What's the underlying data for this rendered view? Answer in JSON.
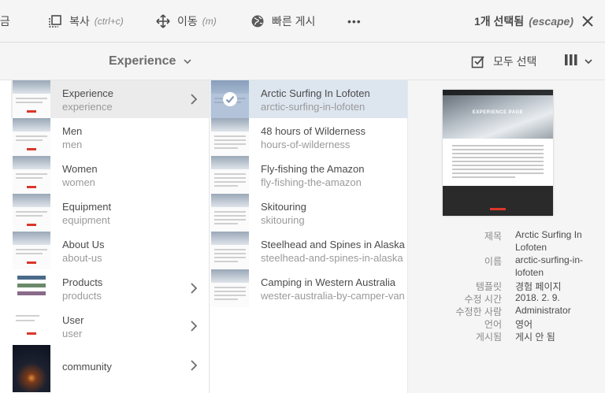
{
  "actionbar": {
    "partial_label": "잠금",
    "copy_label": "복사",
    "copy_shortcut": "(ctrl+c)",
    "move_label": "이동",
    "move_shortcut": "(m)",
    "quickpublish_label": "빠른 게시",
    "more_label": "•••",
    "selection_count": "1개 선택됨",
    "selection_escape": "(escape)"
  },
  "titlebar": {
    "folder_title": "Experience",
    "select_all_label": "모두 선택"
  },
  "column1": [
    {
      "title": "Experience",
      "name": "experience",
      "has_children": true,
      "active": true
    },
    {
      "title": "Men",
      "name": "men",
      "has_children": false
    },
    {
      "title": "Women",
      "name": "women",
      "has_children": false
    },
    {
      "title": "Equipment",
      "name": "equipment",
      "has_children": false
    },
    {
      "title": "About Us",
      "name": "about-us",
      "has_children": false
    },
    {
      "title": "Products",
      "name": "products",
      "has_children": true
    },
    {
      "title": "User",
      "name": "user",
      "has_children": true
    },
    {
      "title": "community",
      "name": "",
      "has_children": true
    }
  ],
  "column2": [
    {
      "title": "Arctic Surfing In Lofoten",
      "name": "arctic-surfing-in-lofoten",
      "selected": true
    },
    {
      "title": "48 hours of Wilderness",
      "name": "hours-of-wilderness"
    },
    {
      "title": "Fly-fishing the Amazon",
      "name": "fly-fishing-the-amazon"
    },
    {
      "title": "Skitouring",
      "name": "skitouring"
    },
    {
      "title": "Steelhead and Spines in Alaska",
      "name": "steelhead-and-spines-in-alaska"
    },
    {
      "title": "Camping in Western Australia",
      "name": "wester-australia-by-camper-van"
    }
  ],
  "preview": {
    "hero_title": "EXPERIENCE PAGE"
  },
  "metadata": {
    "title_key": "제목",
    "title_val_1": "Arctic Surfing In",
    "title_val_2": "Lofoten",
    "name_key": "이름",
    "name_val_1": "arctic-surfing-in-",
    "name_val_2": "lofoten",
    "template_key": "템플릿",
    "template_val": "경험 페이지",
    "modified_key": "수정 시간",
    "modified_val": "2018. 2. 9.",
    "modifiedby_key": "수정한 사람",
    "modifiedby_val": "Administrator",
    "language_key": "언어",
    "language_val": "영어",
    "published_key": "게시됨",
    "published_val": "게시 안 됨"
  },
  "colors": {
    "selected_row": "#dde5ef",
    "active_row": "#ebebeb",
    "accent_red": "#d9372a"
  }
}
